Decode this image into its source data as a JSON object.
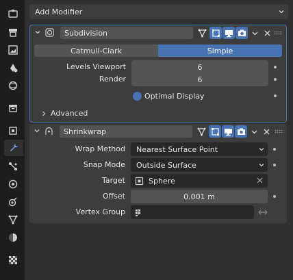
{
  "tabs": [
    {
      "icon": "tool-icon",
      "active": false
    },
    {
      "icon": "render-icon",
      "active": false
    },
    {
      "icon": "output-icon",
      "active": false
    },
    {
      "icon": "view-layer-icon",
      "active": false
    },
    {
      "icon": "scene-icon",
      "active": false
    },
    {
      "icon": "world-icon",
      "active": false
    },
    {
      "icon": "collection-icon",
      "active": false
    },
    {
      "icon": "object-icon",
      "active": false
    },
    {
      "icon": "modifier-wrench-icon",
      "active": true
    },
    {
      "icon": "particles-icon",
      "active": false
    },
    {
      "icon": "physics-icon",
      "active": false
    },
    {
      "icon": "constraints-icon",
      "active": false
    },
    {
      "icon": "object-data-icon",
      "active": false
    },
    {
      "icon": "material-icon",
      "active": false
    },
    {
      "icon": "texture-icon",
      "active": false
    }
  ],
  "add_modifier": {
    "label": "Add Modifier"
  },
  "subdivision": {
    "name": "Subdivision",
    "mode_options": [
      "Catmull-Clark",
      "Simple"
    ],
    "mode_selected": "Simple",
    "levels_viewport_label": "Levels Viewport",
    "levels_viewport_value": "6",
    "render_label": "Render",
    "render_value": "6",
    "optimal_display_label": "Optimal Display",
    "advanced_label": "Advanced"
  },
  "shrinkwrap": {
    "name": "Shrinkwrap",
    "wrap_method_label": "Wrap Method",
    "wrap_method_value": "Nearest Surface Point",
    "snap_mode_label": "Snap Mode",
    "snap_mode_value": "Outside Surface",
    "target_label": "Target",
    "target_value": "Sphere",
    "offset_label": "Offset",
    "offset_value": "0.001 m",
    "vertex_group_label": "Vertex Group",
    "vertex_group_value": ""
  },
  "colors": {
    "accent": "#4772b3",
    "panel": "#3d3d3d",
    "background": "#303030",
    "field": "#545454",
    "dark_field": "#282828",
    "tabbar": "#1d1d1d"
  }
}
